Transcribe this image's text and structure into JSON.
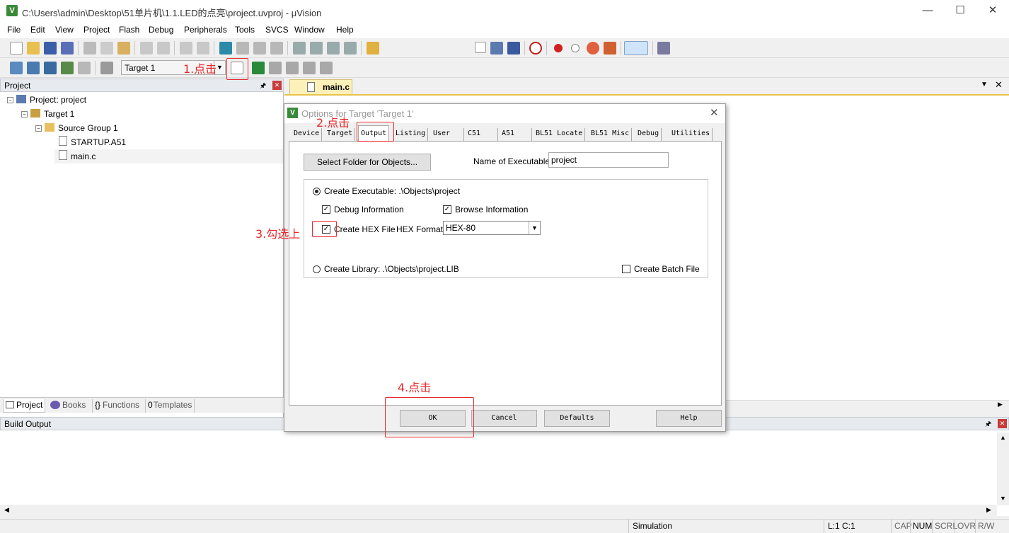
{
  "window": {
    "title": "C:\\Users\\admin\\Desktop\\51单片机\\1.1.LED的点亮\\project.uvproj - μVision",
    "minimize": "—",
    "maximize": "☐",
    "close": "✕"
  },
  "menu": [
    "File",
    "Edit",
    "View",
    "Project",
    "Flash",
    "Debug",
    "Peripherals",
    "Tools",
    "SVCS",
    "Window",
    "Help"
  ],
  "toolbar2": {
    "target_value": "Target 1"
  },
  "project_panel": {
    "title": "Project",
    "tree": [
      {
        "label": "Project: project",
        "level": 0
      },
      {
        "label": "Target 1",
        "level": 1
      },
      {
        "label": "Source Group 1",
        "level": 2
      },
      {
        "label": "STARTUP.A51",
        "level": 3
      },
      {
        "label": "main.c",
        "level": 3
      }
    ],
    "tabs": [
      {
        "label": "Project"
      },
      {
        "label": "Books"
      },
      {
        "label": "Functions"
      },
      {
        "label": "Templates"
      }
    ]
  },
  "editor": {
    "tab_label": "main.c"
  },
  "build_output": {
    "title": "Build Output"
  },
  "status": {
    "mode": "Simulation",
    "position": "L:1 C:1",
    "caps": "CAP",
    "num": "NUM",
    "scrl": "SCRL",
    "ovr": "OVR",
    "rw": "R/W"
  },
  "dialog": {
    "title": "Options for Target 'Target 1'",
    "tabs": [
      "Device",
      "Target",
      "Output",
      "Listing",
      "User",
      "C51",
      "A51",
      "BL51 Locate",
      "BL51 Misc",
      "Debug",
      "Utilities"
    ],
    "active_tab": "Output",
    "select_folder_label": "Select Folder for Objects...",
    "name_exe_label": "Name of Executable:",
    "name_exe_value": "project",
    "create_exe_label": "Create Executable:  .\\Objects\\project",
    "debug_info_label": "Debug Information",
    "browse_info_label": "Browse Information",
    "create_hex_label": "Create HEX File",
    "hex_format_label": "HEX Format:",
    "hex_format_value": "HEX-80",
    "create_lib_label": "Create Library:  .\\Objects\\project.LIB",
    "create_batch_label": "Create Batch File",
    "buttons": {
      "ok": "OK",
      "cancel": "Cancel",
      "defaults": "Defaults",
      "help": "Help"
    }
  },
  "annotations": {
    "step1": "1.点击",
    "step2": "2.点击",
    "step3": "3.勾选上",
    "step4": "4.点击"
  },
  "colors": {
    "annotation": "#e8282b",
    "editor_tab": "#fdf0b8",
    "panel_header": "#e7eaee"
  }
}
